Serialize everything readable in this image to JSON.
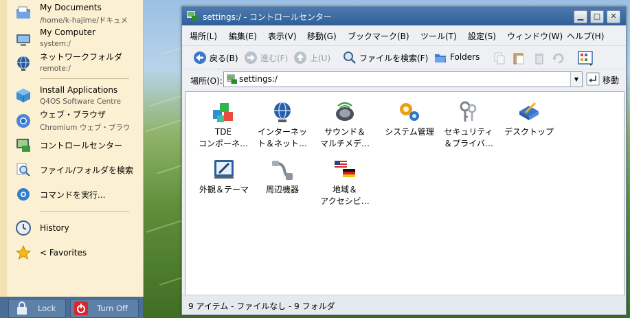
{
  "start_menu": {
    "items": [
      {
        "title": "My Documents",
        "subtitle": "/home/k-hajime/ドキュメ"
      },
      {
        "title": "My Computer",
        "subtitle": "system:/"
      },
      {
        "title": "ネットワークフォルダ",
        "subtitle": "remote:/"
      },
      {
        "title": "Install Applications",
        "subtitle": "Q4OS Software Centre"
      },
      {
        "title": "ウェブ・ブラウザ",
        "subtitle": "Chromium ウェブ・ブラウ"
      },
      {
        "title": "コントロールセンター"
      },
      {
        "title": "ファイル/フォルダを検索"
      },
      {
        "title": "コマンドを実行..."
      },
      {
        "title": "History"
      },
      {
        "title": "< Favorites"
      }
    ],
    "lock_label": "Lock",
    "turnoff_label": "Turn Off"
  },
  "window": {
    "title": "settings:/ - コントロールセンター",
    "menubar": [
      "場所(L)",
      "編集(E)",
      "表示(V)",
      "移動(G)",
      "ブックマーク(B)",
      "ツール(T)",
      "設定(S)",
      "ウィンドウ(W)",
      "ヘルプ(H)"
    ],
    "toolbar": {
      "back": "戻る(B)",
      "forward": "進む(F)",
      "up": "上(U)",
      "find": "ファイルを検索(F)",
      "folders": "Folders"
    },
    "location": {
      "label": "場所(O):",
      "value": "settings:/",
      "go": "移動"
    },
    "items": [
      {
        "l1": "TDE",
        "l2": "コンポーネ…"
      },
      {
        "l1": "インターネッ",
        "l2": "ト＆ネット…"
      },
      {
        "l1": "サウンド＆",
        "l2": "マルチメデ…"
      },
      {
        "l1": "システム管理",
        "l2": ""
      },
      {
        "l1": "セキュリティ",
        "l2": "＆プライバ…"
      },
      {
        "l1": "デスクトップ",
        "l2": ""
      },
      {
        "l1": "外観＆テーマ",
        "l2": ""
      },
      {
        "l1": "周辺機器",
        "l2": ""
      },
      {
        "l1": "地域＆",
        "l2": "アクセシビ…"
      }
    ],
    "status": "9 アイテム - ファイルなし - 9 フォルダ"
  }
}
